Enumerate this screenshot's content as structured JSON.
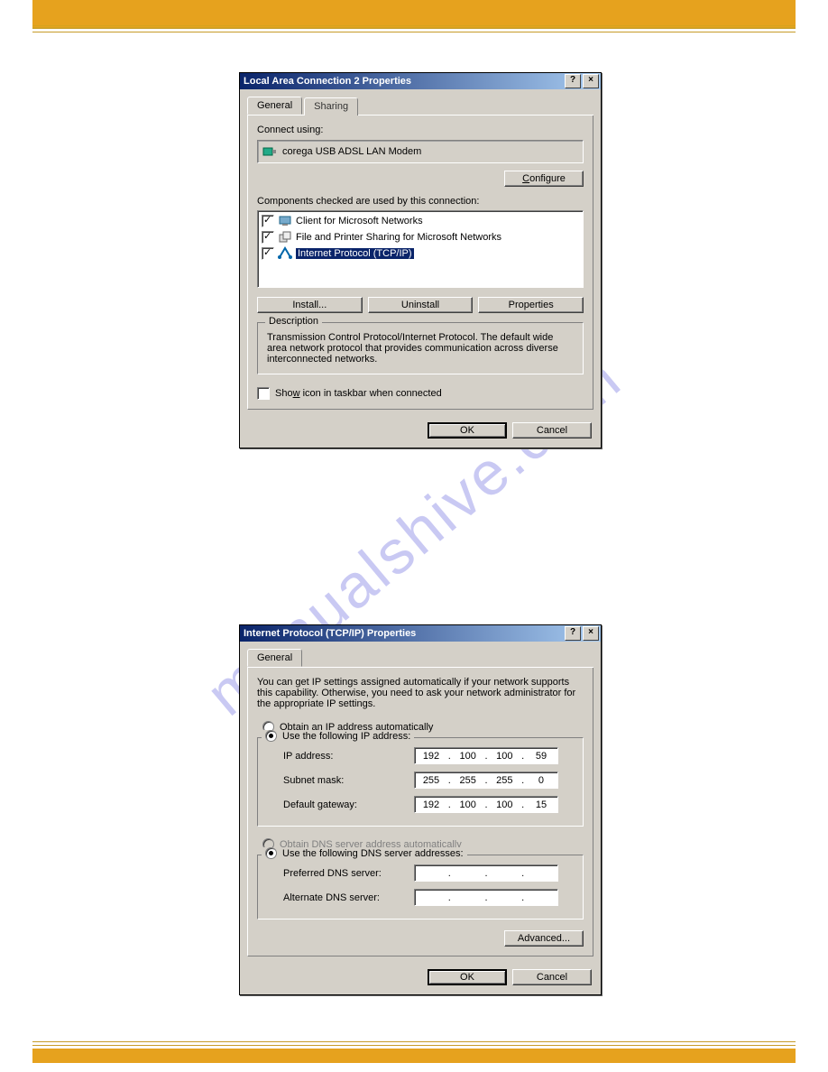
{
  "watermark": "manualshive.com",
  "dialog1": {
    "title": "Local Area Connection 2 Properties",
    "help": "?",
    "close": "×",
    "tabs": {
      "general": "General",
      "sharing": "Sharing"
    },
    "connect_using_label": "Connect using:",
    "adapter": "corega USB ADSL LAN Modem",
    "configure_btn": "Configure",
    "components_label": "Components checked are used by this connection:",
    "items": [
      {
        "label": "Client for Microsoft Networks"
      },
      {
        "label": "File and Printer Sharing for Microsoft Networks"
      },
      {
        "label": "Internet Protocol (TCP/IP)"
      }
    ],
    "install_btn": "Install...",
    "uninstall_btn": "Uninstall",
    "properties_btn": "Properties",
    "desc_legend": "Description",
    "desc_text": "Transmission Control Protocol/Internet Protocol. The default wide area network protocol that provides communication across diverse interconnected networks.",
    "show_icon": "Show icon in taskbar when connected",
    "ok_btn": "OK",
    "cancel_btn": "Cancel"
  },
  "dialog2": {
    "title": "Internet Protocol (TCP/IP) Properties",
    "help": "?",
    "close": "×",
    "tab_general": "General",
    "intro": "You can get IP settings assigned automatically if your network supports this capability. Otherwise, you need to ask your network administrator for the appropriate IP settings.",
    "obtain_ip": "Obtain an IP address automatically",
    "use_ip": "Use the following IP address:",
    "ip_label": "IP address:",
    "ip_value": [
      "192",
      "100",
      "100",
      "59"
    ],
    "subnet_label": "Subnet mask:",
    "subnet_value": [
      "255",
      "255",
      "255",
      "0"
    ],
    "gateway_label": "Default gateway:",
    "gateway_value": [
      "192",
      "100",
      "100",
      "15"
    ],
    "obtain_dns": "Obtain DNS server address automatically",
    "use_dns": "Use the following DNS server addresses:",
    "pref_dns_label": "Preferred DNS server:",
    "alt_dns_label": "Alternate DNS server:",
    "advanced_btn": "Advanced...",
    "ok_btn": "OK",
    "cancel_btn": "Cancel"
  }
}
